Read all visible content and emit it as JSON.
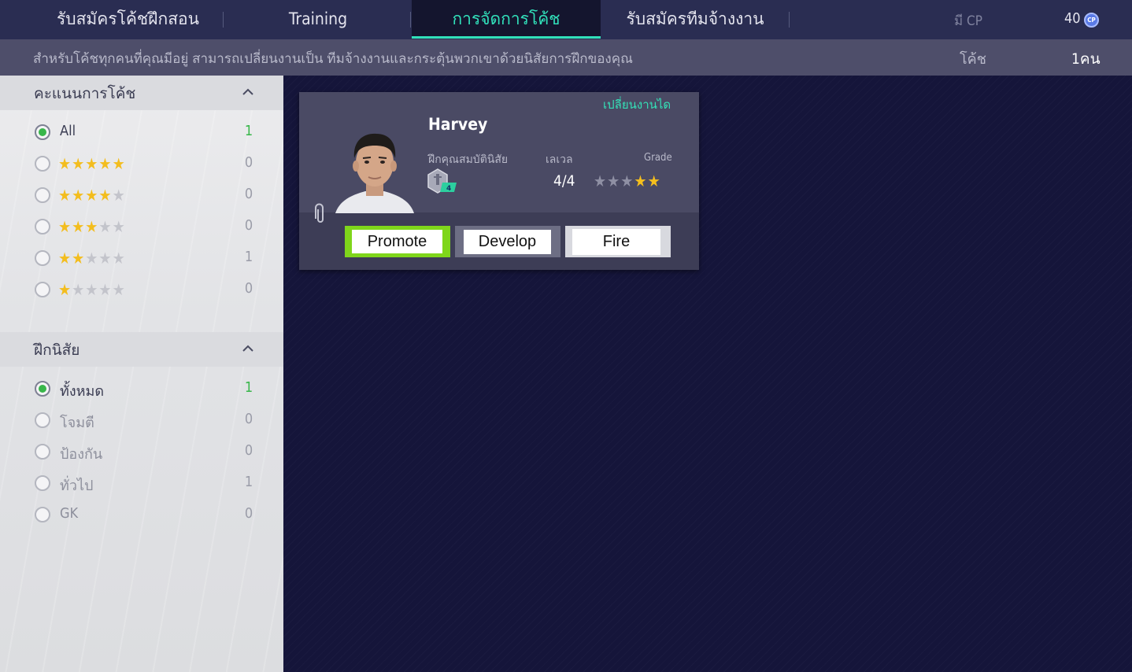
{
  "tabs": [
    {
      "label": "รับสมัครโค้ชฝึกสอน",
      "active": false
    },
    {
      "label": "Training",
      "active": false
    },
    {
      "label": "การจัดการโค้ช",
      "active": true
    },
    {
      "label": "รับสมัครทีมจ้างงาน",
      "active": false
    }
  ],
  "currency": {
    "label": "มี CP",
    "value": "40",
    "icon_text": "CP",
    "icon": "cp-coin-icon"
  },
  "subbar": {
    "description": "สำหรับโค้ชทุกคนที่คุณมีอยู่ สามารถเปลี่ยนงานเป็น ทีมจ้างงานและกระตุ้นพวกเขาด้วยนิสัยการฝึกของคุณ",
    "coach_label": "โค้ช",
    "coach_count": "1คน"
  },
  "filters": {
    "rating": {
      "title": "คะแนนการโค้ช",
      "options": [
        {
          "label": "All",
          "count": "1",
          "selected": true
        },
        {
          "stars": 5,
          "count": "0",
          "selected": false
        },
        {
          "stars": 4,
          "count": "0",
          "selected": false
        },
        {
          "stars": 3,
          "count": "0",
          "selected": false
        },
        {
          "stars": 2,
          "count": "1",
          "selected": false
        },
        {
          "stars": 1,
          "count": "0",
          "selected": false
        }
      ]
    },
    "habit": {
      "title": "ฝึกนิสัย",
      "options": [
        {
          "label": "ทั้งหมด",
          "count": "1",
          "selected": true
        },
        {
          "label": "โจมตี",
          "count": "0",
          "selected": false
        },
        {
          "label": "ป้องกัน",
          "count": "0",
          "selected": false
        },
        {
          "label": "ทั่วไป",
          "count": "1",
          "selected": false
        },
        {
          "label": "GK",
          "count": "0",
          "selected": false
        }
      ]
    }
  },
  "coach_card": {
    "status": "เปลี่ยนงานได",
    "name": "Harvey",
    "attribute_label": "ฝึกคุณสมบัตินิสัย",
    "trait_level": "4",
    "level_label": "เลเวล",
    "level_value": "4/4",
    "grade_label": "Grade",
    "grade_stars": 2,
    "grade_max": 5,
    "buttons": {
      "promote": "Promote",
      "develop": "Develop",
      "fire": "Fire"
    }
  },
  "colors": {
    "accent": "#31e0ba",
    "star": "#f3bd1e",
    "selected_radio": "#38b64a",
    "promote_border": "#7fd61b"
  }
}
